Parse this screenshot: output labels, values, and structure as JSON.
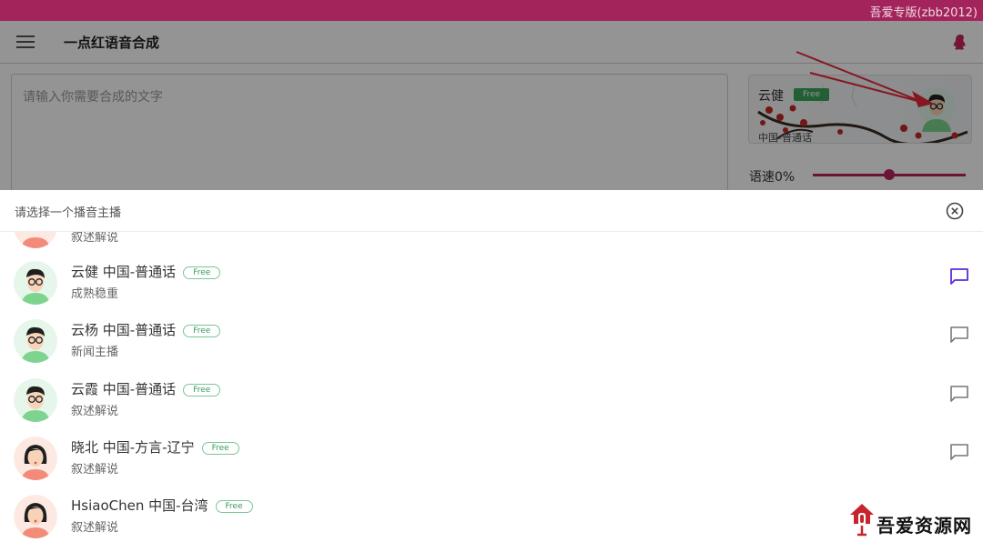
{
  "window": {
    "badge_text": "吾爱专版(zbb2012)"
  },
  "appbar": {
    "title": "一点红语音合成"
  },
  "editor": {
    "placeholder": "请输入你需要合成的文字"
  },
  "voice_card": {
    "name": "云健",
    "free_label": "Free",
    "language": "中国-普通话"
  },
  "speed": {
    "label": "语速0%",
    "value_fraction": 0.5
  },
  "sheet": {
    "title": "请选择一个播音主播",
    "partial_item_desc": "叙述解说",
    "items": [
      {
        "name": "云健 中国-普通话",
        "free": "Free",
        "desc": "成熟稳重",
        "gender": "male",
        "selected": true
      },
      {
        "name": "云杨 中国-普通话",
        "free": "Free",
        "desc": "新闻主播",
        "gender": "male",
        "selected": false
      },
      {
        "name": "云霞 中国-普通话",
        "free": "Free",
        "desc": "叙述解说",
        "gender": "male",
        "selected": false
      },
      {
        "name": "晓北 中国-方言-辽宁",
        "free": "Free",
        "desc": "叙述解说",
        "gender": "female",
        "selected": false
      },
      {
        "name": "HsiaoChen 中国-台湾",
        "free": "Free",
        "desc": "叙述解说",
        "gender": "female",
        "selected": false
      }
    ]
  },
  "watermark": {
    "text": "吾爱资源网"
  },
  "colors": {
    "brand": "#a3245a",
    "accent_selected": "#5b2bd6",
    "free_green": "#3aa55b"
  }
}
